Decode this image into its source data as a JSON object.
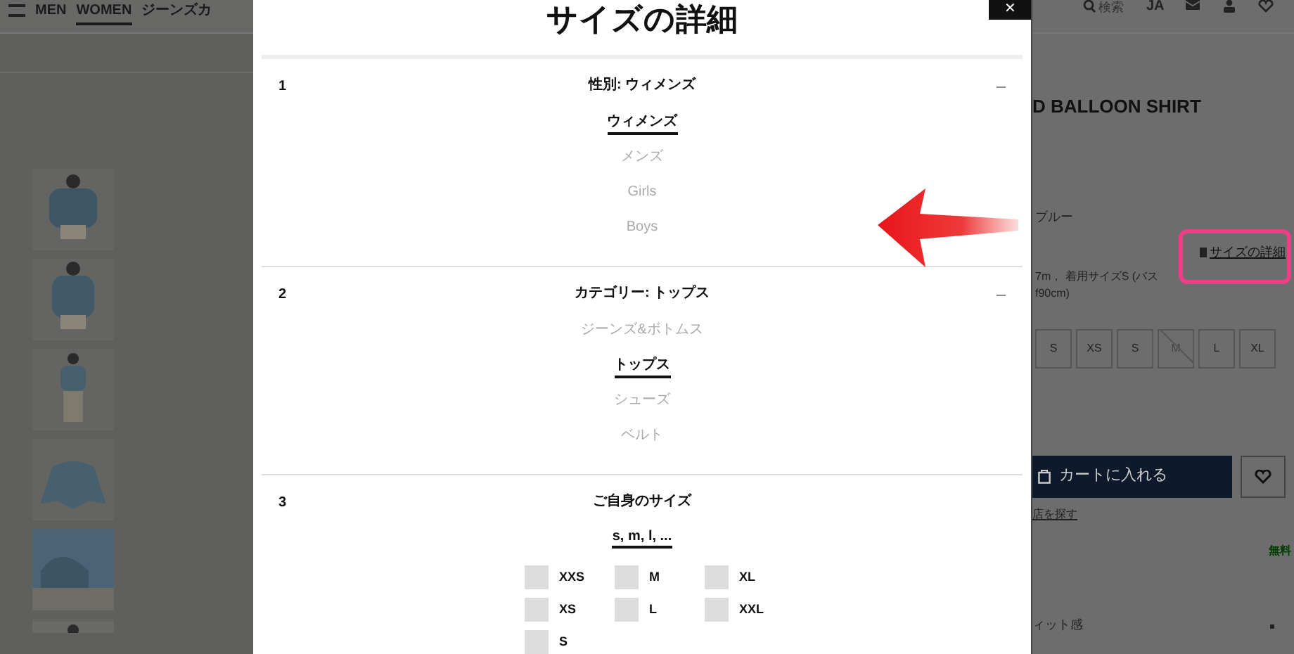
{
  "header": {
    "nav": [
      {
        "label": "MEN",
        "selected": false
      },
      {
        "label": "WOMEN",
        "selected": true
      },
      {
        "label": "ジーンズカ",
        "selected": false
      }
    ],
    "search_label": "検索",
    "language": "JA"
  },
  "product": {
    "title": "D BALLOON SHIRT",
    "color_name": "ブルー",
    "size_guide_link": "サイズの詳細",
    "model_info": [
      "7m， 着用サイズS (バス",
      "f90cm)"
    ],
    "sizes": [
      {
        "label": "S",
        "available": true
      },
      {
        "label": "XS",
        "available": true
      },
      {
        "label": "S",
        "available": true
      },
      {
        "label": "M",
        "available": false
      },
      {
        "label": "L",
        "available": true
      },
      {
        "label": "XL",
        "available": true
      }
    ],
    "add_to_cart": "カートに入れる",
    "store_link": "店を探す",
    "shipping": "無料",
    "section": "ィット感"
  },
  "modal": {
    "title": "サイズの詳細",
    "close": "✕",
    "steps": [
      {
        "number": "1",
        "heading": "性別: ウィメンズ",
        "toggle": "–",
        "options": [
          {
            "label": "ウィメンズ",
            "selected": true
          },
          {
            "label": "メンズ",
            "selected": false
          },
          {
            "label": "Girls",
            "selected": false
          },
          {
            "label": "Boys",
            "selected": false
          }
        ]
      },
      {
        "number": "2",
        "heading": "カテゴリー: トップス",
        "toggle": "–",
        "options": [
          {
            "label": "ジーンズ&ボトムス",
            "selected": false
          },
          {
            "label": "トップス",
            "selected": true
          },
          {
            "label": "シューズ",
            "selected": false
          },
          {
            "label": "ベルト",
            "selected": false
          }
        ]
      },
      {
        "number": "3",
        "heading": "ご自身のサイズ",
        "format_link": "s, m, l, ...",
        "sizes": [
          {
            "label": "XXS",
            "checked": false
          },
          {
            "label": "M",
            "checked": false
          },
          {
            "label": "XL",
            "checked": false
          },
          {
            "label": "XS",
            "checked": false
          },
          {
            "label": "L",
            "checked": false
          },
          {
            "label": "XXL",
            "checked": false
          },
          {
            "label": "S",
            "checked": false
          }
        ]
      }
    ]
  }
}
